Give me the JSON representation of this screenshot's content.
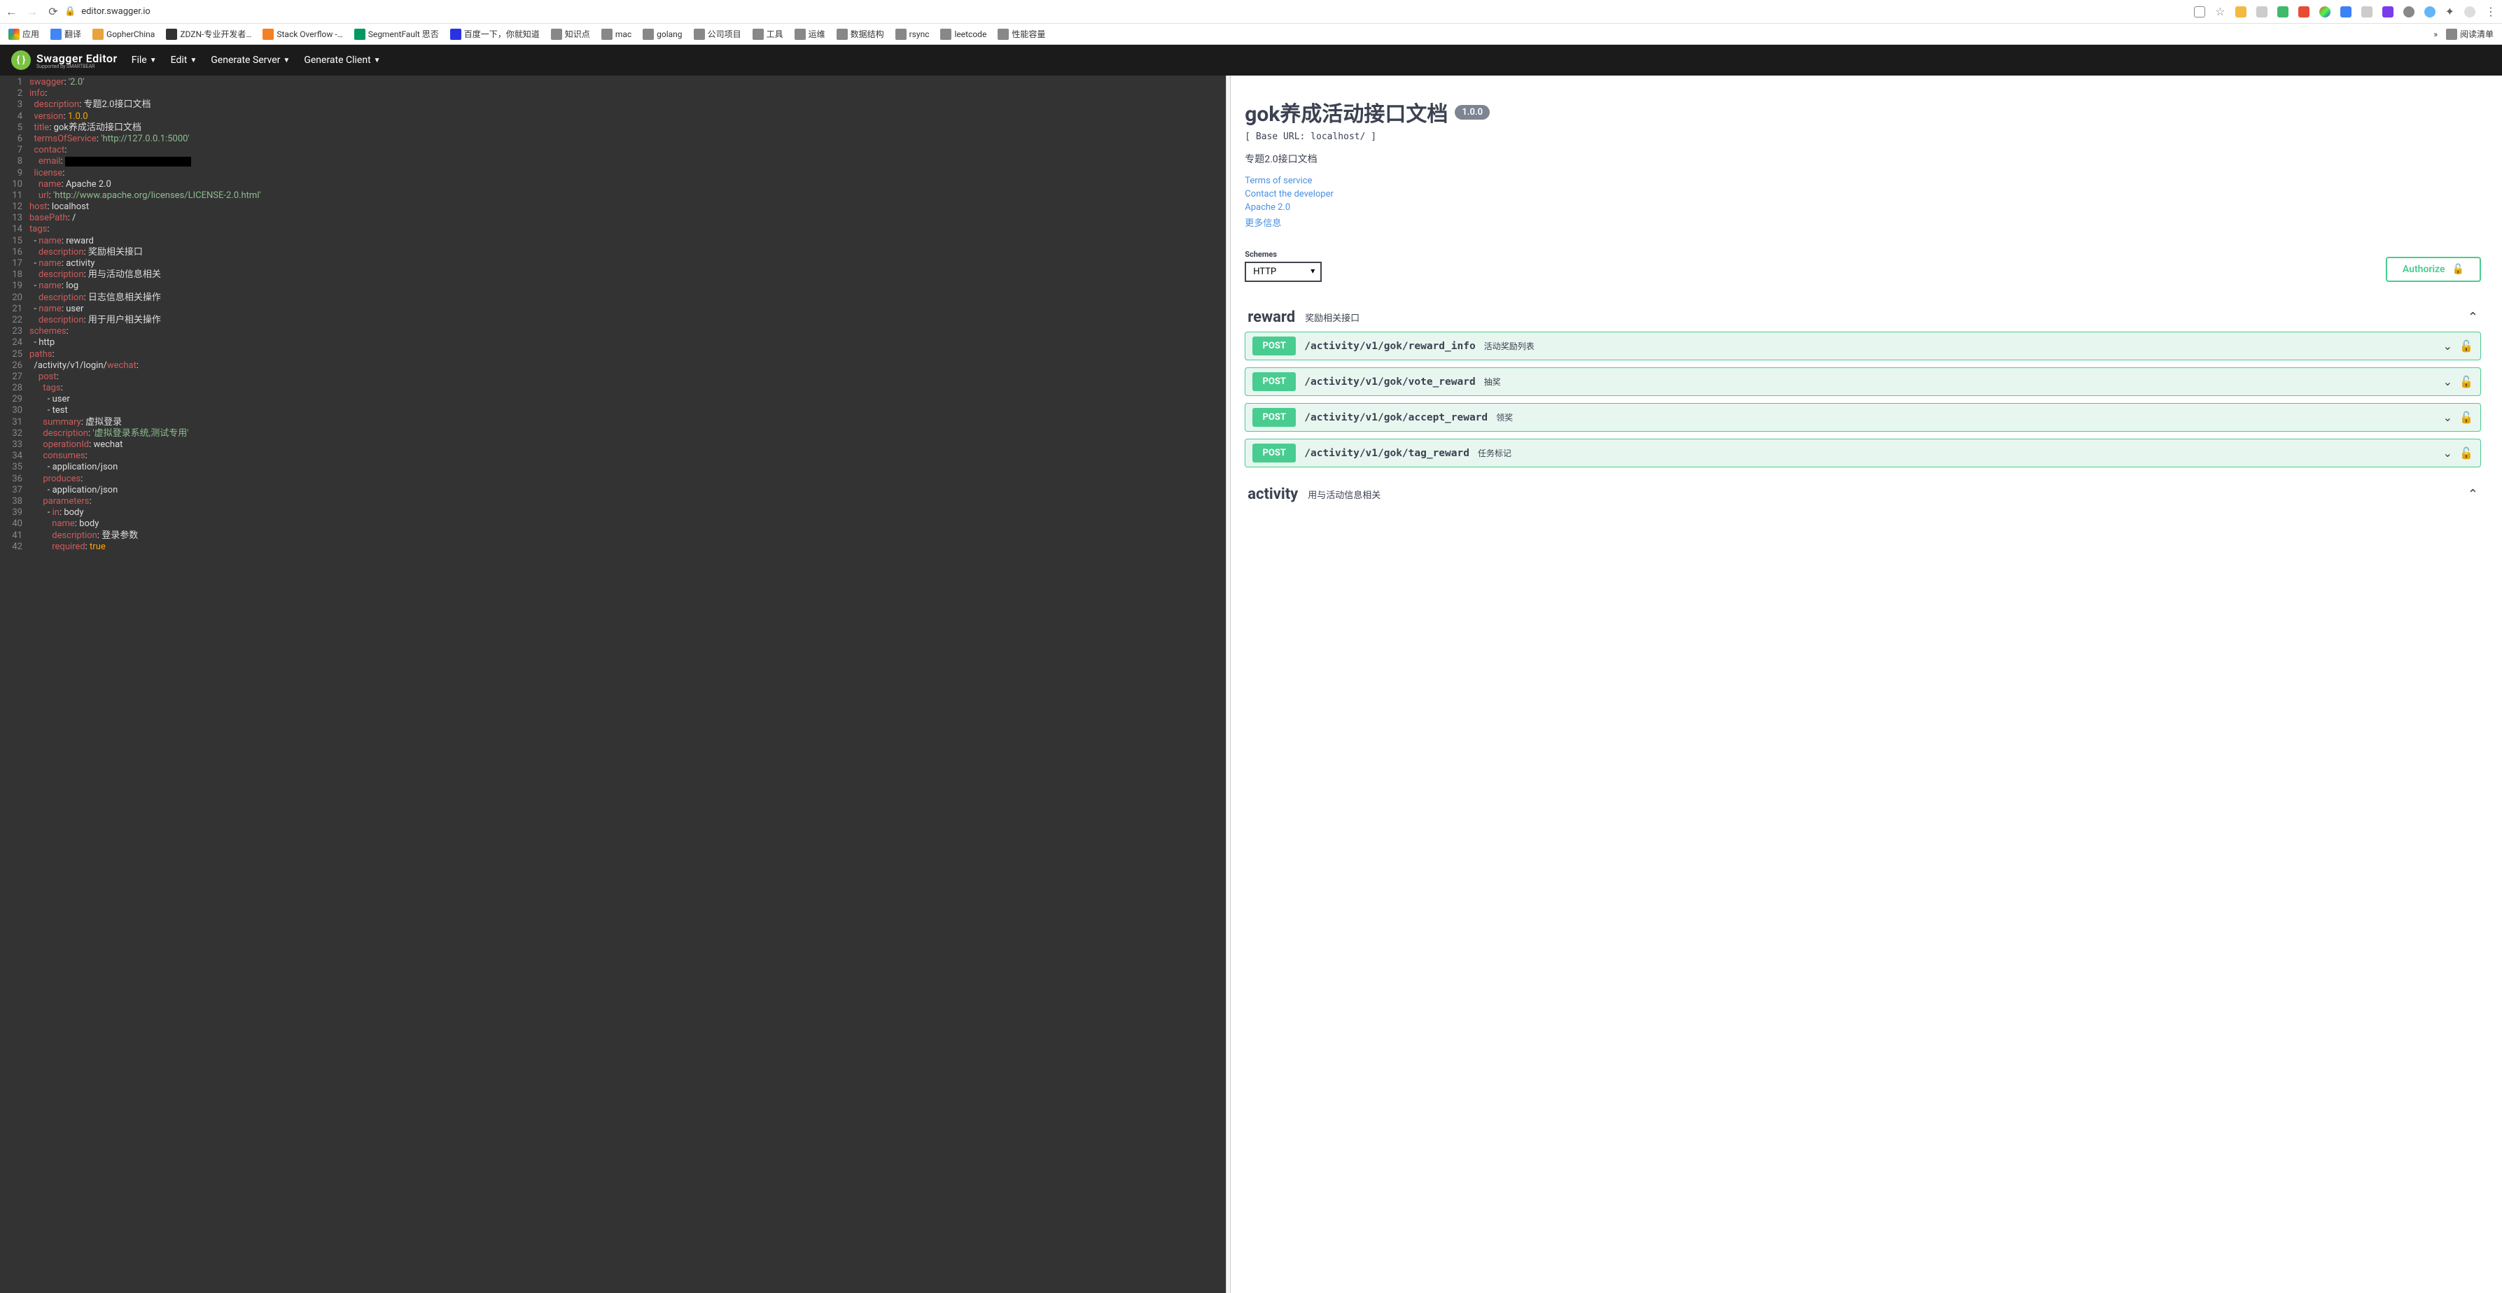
{
  "browser": {
    "url": "editor.swagger.io",
    "reading_list": "阅读清单"
  },
  "bookmarks": {
    "apps": "应用",
    "items": [
      "翻译",
      "GopherChina",
      "ZDZN-专业开发者…",
      "Stack Overflow -…",
      "SegmentFault 思否",
      "百度一下，你就知道",
      "知识点",
      "mac",
      "golang",
      "公司项目",
      "工具",
      "运维",
      "数据结构",
      "rsync",
      "leetcode",
      "性能容量"
    ]
  },
  "menu": {
    "brand": "Swagger Editor",
    "brand_sub": "Supported by SMARTBEAR",
    "file": "File",
    "edit": "Edit",
    "gen_server": "Generate Server",
    "gen_client": "Generate Client"
  },
  "editor": {
    "lines": [
      {
        "n": 1,
        "tokens": [
          [
            "key",
            "swagger"
          ],
          [
            "punct",
            ": "
          ],
          [
            "str",
            "'2.0'"
          ]
        ]
      },
      {
        "n": 2,
        "tokens": [
          [
            "key",
            "info"
          ],
          [
            "punct",
            ":"
          ]
        ]
      },
      {
        "n": 3,
        "tokens": [
          [
            "plain",
            "  "
          ],
          [
            "key",
            "description"
          ],
          [
            "punct",
            ": "
          ],
          [
            "plain",
            "专题2.0接口文档"
          ]
        ]
      },
      {
        "n": 4,
        "tokens": [
          [
            "plain",
            "  "
          ],
          [
            "key",
            "version"
          ],
          [
            "punct",
            ": "
          ],
          [
            "num",
            "1.0.0"
          ]
        ]
      },
      {
        "n": 5,
        "tokens": [
          [
            "plain",
            "  "
          ],
          [
            "key",
            "title"
          ],
          [
            "punct",
            ": "
          ],
          [
            "plain",
            "gok养成活动接口文档"
          ]
        ]
      },
      {
        "n": 6,
        "tokens": [
          [
            "plain",
            "  "
          ],
          [
            "key",
            "termsOfService"
          ],
          [
            "punct",
            ": "
          ],
          [
            "str",
            "'http://127.0.0.1:5000'"
          ]
        ]
      },
      {
        "n": 7,
        "tokens": [
          [
            "plain",
            "  "
          ],
          [
            "key",
            "contact"
          ],
          [
            "punct",
            ":"
          ]
        ]
      },
      {
        "n": 8,
        "tokens": [
          [
            "plain",
            "    "
          ],
          [
            "key",
            "email"
          ],
          [
            "punct",
            ": "
          ],
          [
            "redacted",
            ""
          ]
        ]
      },
      {
        "n": 9,
        "tokens": [
          [
            "plain",
            "  "
          ],
          [
            "key",
            "license"
          ],
          [
            "punct",
            ":"
          ]
        ]
      },
      {
        "n": 10,
        "tokens": [
          [
            "plain",
            "    "
          ],
          [
            "key",
            "name"
          ],
          [
            "punct",
            ": "
          ],
          [
            "plain",
            "Apache 2.0"
          ]
        ]
      },
      {
        "n": 11,
        "tokens": [
          [
            "plain",
            "    "
          ],
          [
            "key",
            "url"
          ],
          [
            "punct",
            ": "
          ],
          [
            "str",
            "'http://www.apache.org/licenses/LICENSE-2.0.html'"
          ]
        ]
      },
      {
        "n": 12,
        "tokens": [
          [
            "key",
            "host"
          ],
          [
            "punct",
            ": "
          ],
          [
            "plain",
            "localhost"
          ]
        ]
      },
      {
        "n": 13,
        "tokens": [
          [
            "key",
            "basePath"
          ],
          [
            "punct",
            ": "
          ],
          [
            "plain",
            "/"
          ]
        ]
      },
      {
        "n": 14,
        "tokens": [
          [
            "key",
            "tags"
          ],
          [
            "punct",
            ":"
          ]
        ]
      },
      {
        "n": 15,
        "tokens": [
          [
            "plain",
            "  - "
          ],
          [
            "key",
            "name"
          ],
          [
            "punct",
            ": "
          ],
          [
            "plain",
            "reward"
          ]
        ]
      },
      {
        "n": 16,
        "tokens": [
          [
            "plain",
            "    "
          ],
          [
            "key",
            "description"
          ],
          [
            "punct",
            ": "
          ],
          [
            "plain",
            "奖励相关接口"
          ]
        ]
      },
      {
        "n": 17,
        "tokens": [
          [
            "plain",
            "  - "
          ],
          [
            "key",
            "name"
          ],
          [
            "punct",
            ": "
          ],
          [
            "plain",
            "activity"
          ]
        ]
      },
      {
        "n": 18,
        "tokens": [
          [
            "plain",
            "    "
          ],
          [
            "key",
            "description"
          ],
          [
            "punct",
            ": "
          ],
          [
            "plain",
            "用与活动信息相关"
          ]
        ]
      },
      {
        "n": 19,
        "tokens": [
          [
            "plain",
            "  - "
          ],
          [
            "key",
            "name"
          ],
          [
            "punct",
            ": "
          ],
          [
            "plain",
            "log"
          ]
        ]
      },
      {
        "n": 20,
        "tokens": [
          [
            "plain",
            "    "
          ],
          [
            "key",
            "description"
          ],
          [
            "punct",
            ": "
          ],
          [
            "plain",
            "日志信息相关操作"
          ]
        ]
      },
      {
        "n": 21,
        "tokens": [
          [
            "plain",
            "  - "
          ],
          [
            "key",
            "name"
          ],
          [
            "punct",
            ": "
          ],
          [
            "plain",
            "user"
          ]
        ]
      },
      {
        "n": 22,
        "tokens": [
          [
            "plain",
            "    "
          ],
          [
            "key",
            "description"
          ],
          [
            "punct",
            ": "
          ],
          [
            "plain",
            "用于用户相关操作"
          ]
        ]
      },
      {
        "n": 23,
        "tokens": [
          [
            "key",
            "schemes"
          ],
          [
            "punct",
            ":"
          ]
        ]
      },
      {
        "n": 24,
        "tokens": [
          [
            "plain",
            "  - http"
          ]
        ]
      },
      {
        "n": 25,
        "tokens": [
          [
            "key",
            "paths"
          ],
          [
            "punct",
            ":"
          ]
        ]
      },
      {
        "n": 26,
        "tokens": [
          [
            "plain",
            "  /activity/v1/login/"
          ],
          [
            "key",
            "wechat"
          ],
          [
            "punct",
            ":"
          ]
        ]
      },
      {
        "n": 27,
        "tokens": [
          [
            "plain",
            "    "
          ],
          [
            "key",
            "post"
          ],
          [
            "punct",
            ":"
          ]
        ]
      },
      {
        "n": 28,
        "tokens": [
          [
            "plain",
            "      "
          ],
          [
            "key",
            "tags"
          ],
          [
            "punct",
            ":"
          ]
        ]
      },
      {
        "n": 29,
        "tokens": [
          [
            "plain",
            "        - user"
          ]
        ]
      },
      {
        "n": 30,
        "tokens": [
          [
            "plain",
            "        - test"
          ]
        ]
      },
      {
        "n": 31,
        "tokens": [
          [
            "plain",
            "      "
          ],
          [
            "key",
            "summary"
          ],
          [
            "punct",
            ": "
          ],
          [
            "plain",
            "虚拟登录"
          ]
        ]
      },
      {
        "n": 32,
        "tokens": [
          [
            "plain",
            "      "
          ],
          [
            "key",
            "description"
          ],
          [
            "punct",
            ": "
          ],
          [
            "str",
            "'虚拟登录系统,测试专用'"
          ]
        ]
      },
      {
        "n": 33,
        "tokens": [
          [
            "plain",
            "      "
          ],
          [
            "key",
            "operationId"
          ],
          [
            "punct",
            ": "
          ],
          [
            "plain",
            "wechat"
          ]
        ]
      },
      {
        "n": 34,
        "tokens": [
          [
            "plain",
            "      "
          ],
          [
            "key",
            "consumes"
          ],
          [
            "punct",
            ":"
          ]
        ]
      },
      {
        "n": 35,
        "tokens": [
          [
            "plain",
            "        - application/json"
          ]
        ]
      },
      {
        "n": 36,
        "tokens": [
          [
            "plain",
            "      "
          ],
          [
            "key",
            "produces"
          ],
          [
            "punct",
            ":"
          ]
        ]
      },
      {
        "n": 37,
        "tokens": [
          [
            "plain",
            "        - application/json"
          ]
        ]
      },
      {
        "n": 38,
        "tokens": [
          [
            "plain",
            "      "
          ],
          [
            "key",
            "parameters"
          ],
          [
            "punct",
            ":"
          ]
        ]
      },
      {
        "n": 39,
        "tokens": [
          [
            "plain",
            "        - "
          ],
          [
            "key",
            "in"
          ],
          [
            "punct",
            ": "
          ],
          [
            "plain",
            "body"
          ]
        ]
      },
      {
        "n": 40,
        "tokens": [
          [
            "plain",
            "          "
          ],
          [
            "key",
            "name"
          ],
          [
            "punct",
            ": "
          ],
          [
            "plain",
            "body"
          ]
        ]
      },
      {
        "n": 41,
        "tokens": [
          [
            "plain",
            "          "
          ],
          [
            "key",
            "description"
          ],
          [
            "punct",
            ": "
          ],
          [
            "plain",
            "登录参数"
          ]
        ]
      },
      {
        "n": 42,
        "tokens": [
          [
            "plain",
            "          "
          ],
          [
            "key",
            "required"
          ],
          [
            "punct",
            ": "
          ],
          [
            "num",
            "true"
          ]
        ]
      }
    ]
  },
  "preview": {
    "title": "gok养成活动接口文档",
    "version": "1.0.0",
    "base_url": "[ Base URL: localhost/ ]",
    "description": "专题2.0接口文档",
    "links": {
      "tos": "Terms of service",
      "contact": "Contact the developer",
      "license": "Apache 2.0",
      "more": "更多信息"
    },
    "schemes_label": "Schemes",
    "scheme_value": "HTTP",
    "authorize": "Authorize",
    "tags": [
      {
        "name": "reward",
        "desc": "奖励相关接口",
        "ops": [
          {
            "method": "POST",
            "path": "/activity/v1/gok/reward_info",
            "summary": "活动奖励列表"
          },
          {
            "method": "POST",
            "path": "/activity/v1/gok/vote_reward",
            "summary": "抽奖"
          },
          {
            "method": "POST",
            "path": "/activity/v1/gok/accept_reward",
            "summary": "领奖"
          },
          {
            "method": "POST",
            "path": "/activity/v1/gok/tag_reward",
            "summary": "任务标记"
          }
        ]
      },
      {
        "name": "activity",
        "desc": "用与活动信息相关",
        "ops": []
      }
    ]
  }
}
